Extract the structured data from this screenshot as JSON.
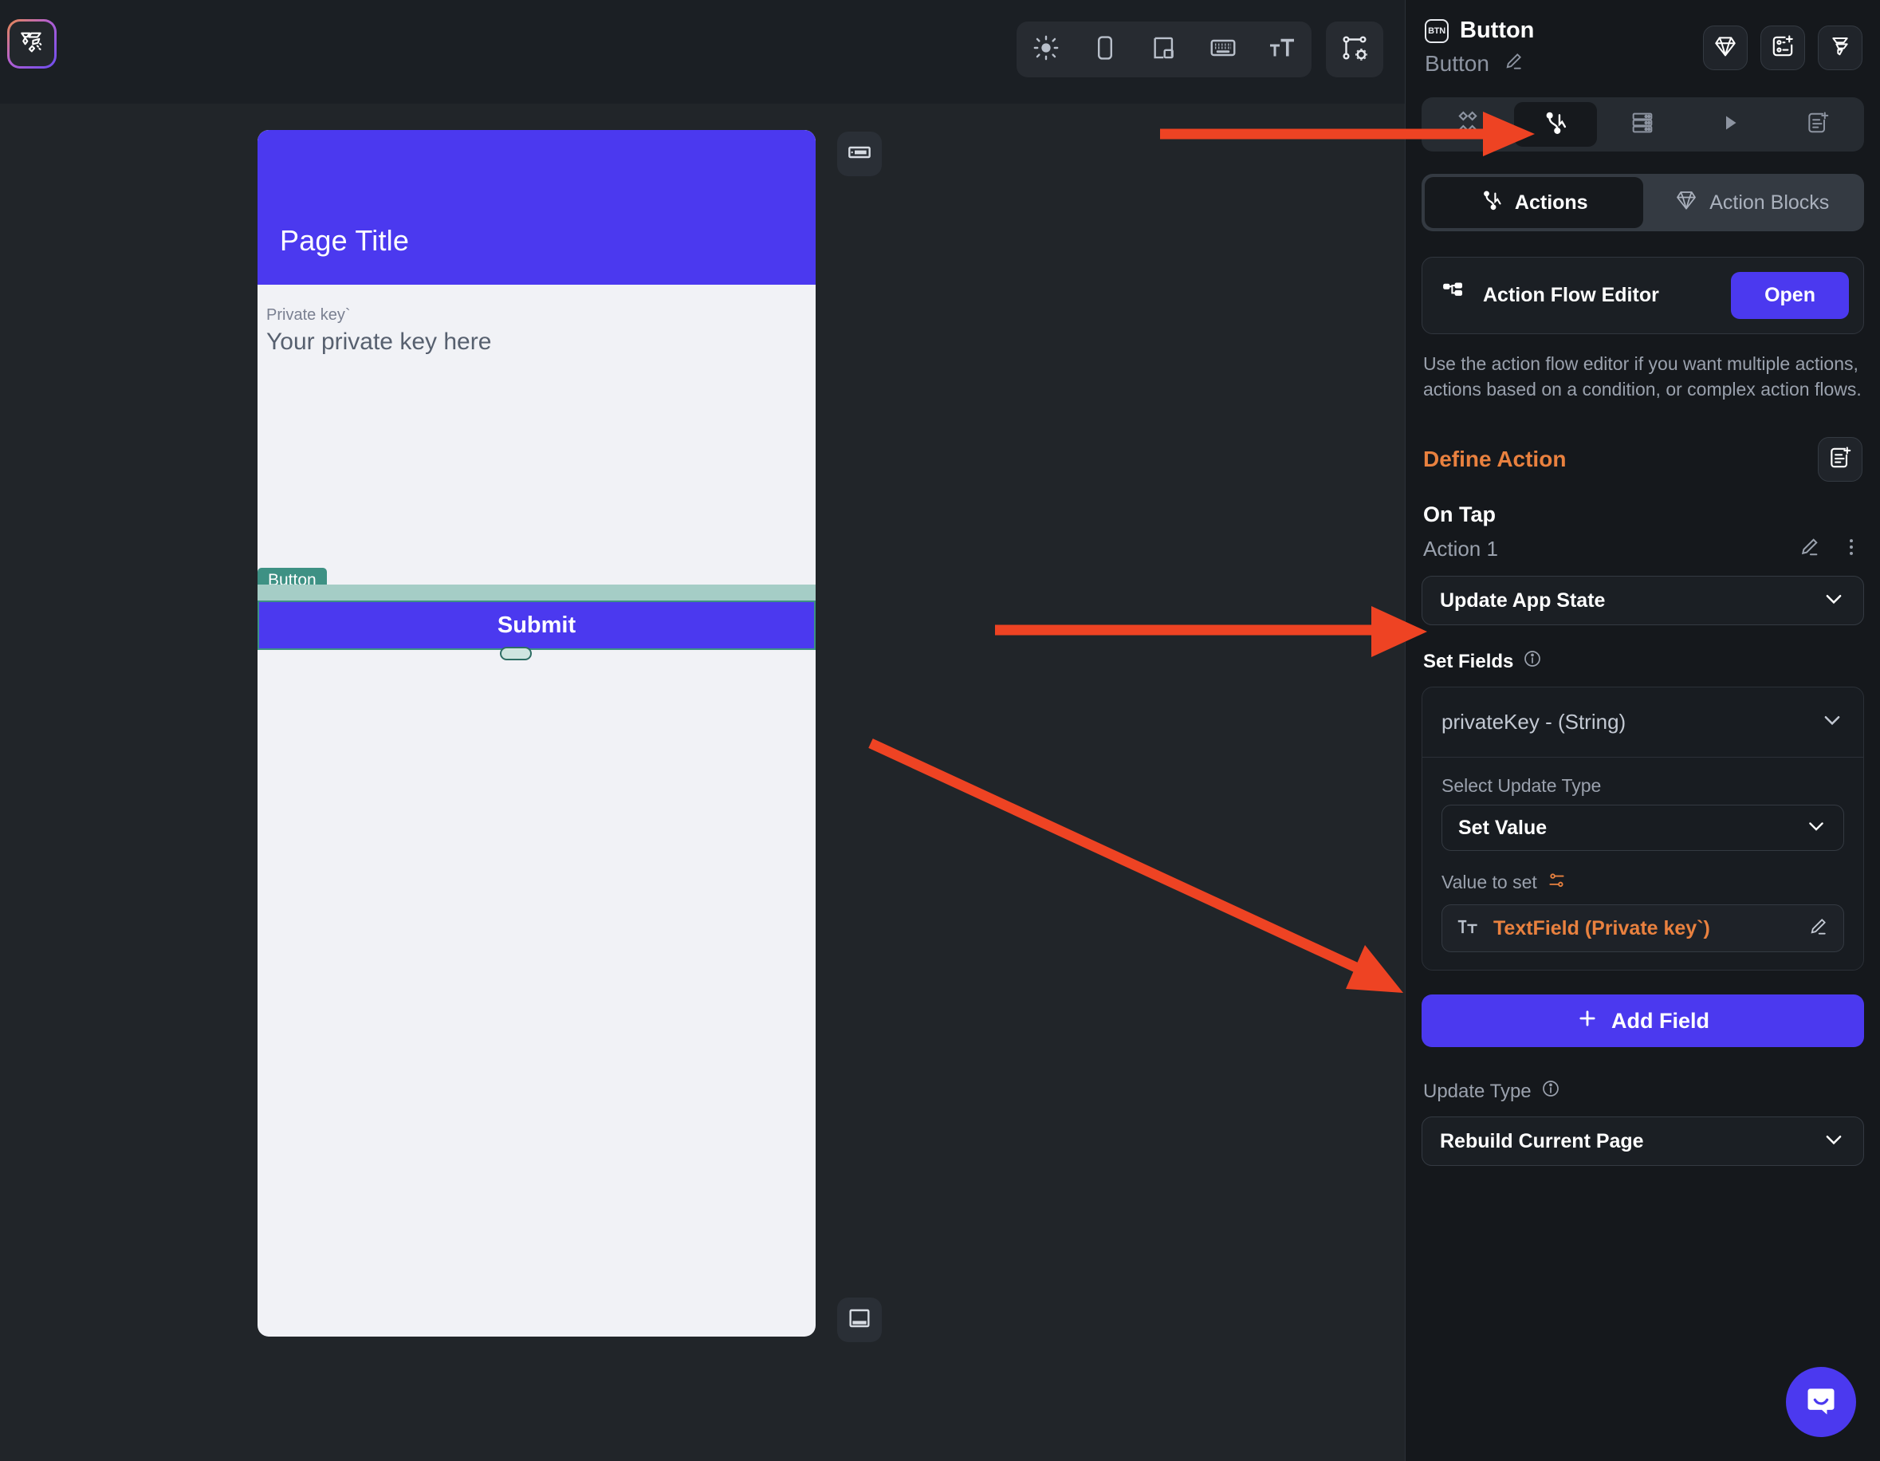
{
  "app": {
    "logo_icon": "flutterflow-logo-icon"
  },
  "toolbar": {
    "items": [
      {
        "name": "theme-brightness-icon",
        "label": "Theme Mode"
      },
      {
        "name": "device-phone-icon",
        "label": "Device Preview"
      },
      {
        "name": "responsive-layout-icon",
        "label": "Responsive Layout"
      },
      {
        "name": "keyboard-icon",
        "label": "Keyboard"
      },
      {
        "name": "text-scale-icon",
        "label": "Text Scale"
      }
    ],
    "extra": {
      "name": "widget-settings-icon",
      "label": "Widget Tree Settings"
    }
  },
  "canvas": {
    "appbar_toggle_icon": "appbar-toggle-icon",
    "bottombar_toggle_icon": "bottombar-toggle-icon",
    "phone": {
      "page_title": "Page Title",
      "textfield_label": "Private key`",
      "textfield_hint": "Your private key here",
      "selected_widget_tag": "Button",
      "button_label": "Submit"
    }
  },
  "panel": {
    "widget_chip": "BTN",
    "title": "Button",
    "subtitle": "Button",
    "rename_icon": "pencil-edit-icon",
    "header_icons": [
      {
        "name": "diamond-component-icon"
      },
      {
        "name": "add-component-icon"
      },
      {
        "name": "flutterflow-mark-icon"
      }
    ],
    "segments": [
      {
        "name": "properties-icon",
        "label": "Properties",
        "active": false
      },
      {
        "name": "actions-icon",
        "label": "Actions",
        "active": true
      },
      {
        "name": "backend-query-icon",
        "label": "Backend Query",
        "active": false
      },
      {
        "name": "animations-play-icon",
        "label": "Animations",
        "active": false
      },
      {
        "name": "generate-doc-icon",
        "label": "Documentation",
        "active": false
      }
    ],
    "tabs": [
      {
        "name": "tab-actions",
        "icon": "actions-icon",
        "label": "Actions",
        "active": true
      },
      {
        "name": "tab-action-blocks",
        "icon": "diamond-icon",
        "label": "Action Blocks",
        "active": false
      }
    ],
    "action_flow_editor": {
      "icon": "flow-editor-icon",
      "label": "Action Flow Editor",
      "open_label": "Open",
      "hint": "Use the action flow editor if you want multiple actions, actions based on a condition, or complex action flows."
    },
    "define_action": {
      "title": "Define Action",
      "add_icon": "add-action-doc-icon",
      "trigger": "On Tap",
      "action_name": "Action 1",
      "edit_icon": "pencil-edit-icon",
      "more_icon": "more-vertical-icon",
      "action_type": "Update App State",
      "chevron_icon": "chevron-down-icon"
    },
    "set_fields": {
      "label": "Set Fields",
      "info_icon": "info-circle-icon",
      "field_name": "privateKey - (String)",
      "update_type_label": "Select Update Type",
      "update_type_value": "Set Value",
      "value_to_set_label": "Value to set",
      "value_to_set_icon": "variable-settings-icon",
      "value_token_icon": "text-field-icon",
      "value_token_text": "TextField (Private key`)",
      "value_token_edit_icon": "pencil-edit-icon",
      "add_field_label": "Add Field",
      "add_field_icon": "plus-icon"
    },
    "update_type": {
      "label": "Update Type",
      "info_icon": "info-circle-icon",
      "value": "Rebuild Current Page"
    }
  },
  "support": {
    "intercom_icon": "chat-bubble-icon"
  },
  "colors": {
    "accent_primary": "#4b39ef",
    "accent_orange": "#e9813f",
    "annotation_red": "#ee4323",
    "selection_teal": "#3e9184",
    "panel_bg": "#15181c",
    "canvas_bg": "#212529"
  },
  "annotations": [
    {
      "name": "arrow-to-actions-tab-icon"
    },
    {
      "name": "arrow-to-update-app-state"
    },
    {
      "name": "arrow-to-value-token"
    }
  ]
}
